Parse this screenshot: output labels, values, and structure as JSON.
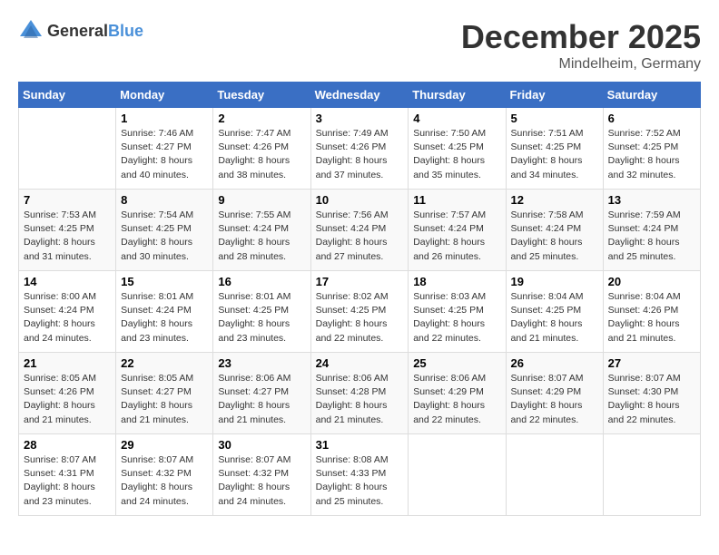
{
  "logo": {
    "general": "General",
    "blue": "Blue"
  },
  "title": "December 2025",
  "location": "Mindelheim, Germany",
  "days_header": [
    "Sunday",
    "Monday",
    "Tuesday",
    "Wednesday",
    "Thursday",
    "Friday",
    "Saturday"
  ],
  "weeks": [
    [
      {
        "num": "",
        "detail": ""
      },
      {
        "num": "1",
        "detail": "Sunrise: 7:46 AM\nSunset: 4:27 PM\nDaylight: 8 hours\nand 40 minutes."
      },
      {
        "num": "2",
        "detail": "Sunrise: 7:47 AM\nSunset: 4:26 PM\nDaylight: 8 hours\nand 38 minutes."
      },
      {
        "num": "3",
        "detail": "Sunrise: 7:49 AM\nSunset: 4:26 PM\nDaylight: 8 hours\nand 37 minutes."
      },
      {
        "num": "4",
        "detail": "Sunrise: 7:50 AM\nSunset: 4:25 PM\nDaylight: 8 hours\nand 35 minutes."
      },
      {
        "num": "5",
        "detail": "Sunrise: 7:51 AM\nSunset: 4:25 PM\nDaylight: 8 hours\nand 34 minutes."
      },
      {
        "num": "6",
        "detail": "Sunrise: 7:52 AM\nSunset: 4:25 PM\nDaylight: 8 hours\nand 32 minutes."
      }
    ],
    [
      {
        "num": "7",
        "detail": "Sunrise: 7:53 AM\nSunset: 4:25 PM\nDaylight: 8 hours\nand 31 minutes."
      },
      {
        "num": "8",
        "detail": "Sunrise: 7:54 AM\nSunset: 4:25 PM\nDaylight: 8 hours\nand 30 minutes."
      },
      {
        "num": "9",
        "detail": "Sunrise: 7:55 AM\nSunset: 4:24 PM\nDaylight: 8 hours\nand 28 minutes."
      },
      {
        "num": "10",
        "detail": "Sunrise: 7:56 AM\nSunset: 4:24 PM\nDaylight: 8 hours\nand 27 minutes."
      },
      {
        "num": "11",
        "detail": "Sunrise: 7:57 AM\nSunset: 4:24 PM\nDaylight: 8 hours\nand 26 minutes."
      },
      {
        "num": "12",
        "detail": "Sunrise: 7:58 AM\nSunset: 4:24 PM\nDaylight: 8 hours\nand 25 minutes."
      },
      {
        "num": "13",
        "detail": "Sunrise: 7:59 AM\nSunset: 4:24 PM\nDaylight: 8 hours\nand 25 minutes."
      }
    ],
    [
      {
        "num": "14",
        "detail": "Sunrise: 8:00 AM\nSunset: 4:24 PM\nDaylight: 8 hours\nand 24 minutes."
      },
      {
        "num": "15",
        "detail": "Sunrise: 8:01 AM\nSunset: 4:24 PM\nDaylight: 8 hours\nand 23 minutes."
      },
      {
        "num": "16",
        "detail": "Sunrise: 8:01 AM\nSunset: 4:25 PM\nDaylight: 8 hours\nand 23 minutes."
      },
      {
        "num": "17",
        "detail": "Sunrise: 8:02 AM\nSunset: 4:25 PM\nDaylight: 8 hours\nand 22 minutes."
      },
      {
        "num": "18",
        "detail": "Sunrise: 8:03 AM\nSunset: 4:25 PM\nDaylight: 8 hours\nand 22 minutes."
      },
      {
        "num": "19",
        "detail": "Sunrise: 8:04 AM\nSunset: 4:25 PM\nDaylight: 8 hours\nand 21 minutes."
      },
      {
        "num": "20",
        "detail": "Sunrise: 8:04 AM\nSunset: 4:26 PM\nDaylight: 8 hours\nand 21 minutes."
      }
    ],
    [
      {
        "num": "21",
        "detail": "Sunrise: 8:05 AM\nSunset: 4:26 PM\nDaylight: 8 hours\nand 21 minutes."
      },
      {
        "num": "22",
        "detail": "Sunrise: 8:05 AM\nSunset: 4:27 PM\nDaylight: 8 hours\nand 21 minutes."
      },
      {
        "num": "23",
        "detail": "Sunrise: 8:06 AM\nSunset: 4:27 PM\nDaylight: 8 hours\nand 21 minutes."
      },
      {
        "num": "24",
        "detail": "Sunrise: 8:06 AM\nSunset: 4:28 PM\nDaylight: 8 hours\nand 21 minutes."
      },
      {
        "num": "25",
        "detail": "Sunrise: 8:06 AM\nSunset: 4:29 PM\nDaylight: 8 hours\nand 22 minutes."
      },
      {
        "num": "26",
        "detail": "Sunrise: 8:07 AM\nSunset: 4:29 PM\nDaylight: 8 hours\nand 22 minutes."
      },
      {
        "num": "27",
        "detail": "Sunrise: 8:07 AM\nSunset: 4:30 PM\nDaylight: 8 hours\nand 22 minutes."
      }
    ],
    [
      {
        "num": "28",
        "detail": "Sunrise: 8:07 AM\nSunset: 4:31 PM\nDaylight: 8 hours\nand 23 minutes."
      },
      {
        "num": "29",
        "detail": "Sunrise: 8:07 AM\nSunset: 4:32 PM\nDaylight: 8 hours\nand 24 minutes."
      },
      {
        "num": "30",
        "detail": "Sunrise: 8:07 AM\nSunset: 4:32 PM\nDaylight: 8 hours\nand 24 minutes."
      },
      {
        "num": "31",
        "detail": "Sunrise: 8:08 AM\nSunset: 4:33 PM\nDaylight: 8 hours\nand 25 minutes."
      },
      {
        "num": "",
        "detail": ""
      },
      {
        "num": "",
        "detail": ""
      },
      {
        "num": "",
        "detail": ""
      }
    ]
  ]
}
